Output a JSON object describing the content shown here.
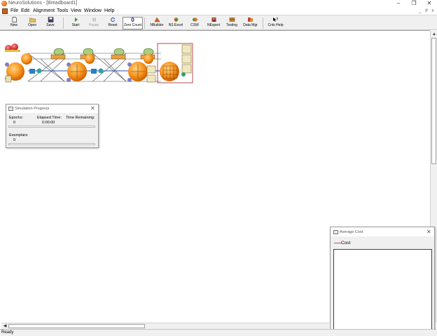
{
  "window": {
    "title": "NeuroSolutions - [Breadboard1]",
    "minimize": "–",
    "maximize": "❐",
    "close": "✕"
  },
  "menu": {
    "items": [
      "File",
      "Edit",
      "Alignment",
      "Tools",
      "View",
      "Window",
      "Help"
    ],
    "mdi_minimize": "_",
    "mdi_restore": "#",
    "mdi_close": "x"
  },
  "toolbar": {
    "new": "New",
    "open": "Open",
    "save": "Save",
    "start": "Start",
    "pause": "Pause",
    "reset": "Reset",
    "zero_count_value": "0",
    "zero_count": "Zero Count",
    "nbuilder": "NBuilder",
    "ns_excel": "NS Excel",
    "csw": "CSW",
    "nexpert": "NExpert",
    "testing": "Testing",
    "data_mgr": "Data Mgr",
    "cntx_help": "Cntx Help"
  },
  "simulation_window": {
    "title": "Simulation Progress",
    "close": "✕",
    "epochs_label": "Epochs:",
    "epochs_value": "0",
    "elapsed_label": "Elapsed Time:",
    "elapsed_value": "0:00:00",
    "remaining_label": "Time Remaining:",
    "remaining_value": "",
    "exemplars_label": "Exemplars:",
    "exemplars_value": "0"
  },
  "cost_window": {
    "title": "Average Cost",
    "close": "✕",
    "legend": "Cost",
    "legend_color": "#c05050"
  },
  "status": {
    "text": "Ready"
  },
  "colors": {
    "accent_orange": "#f7941d",
    "toolbar_bg": "#f0f0f0"
  }
}
